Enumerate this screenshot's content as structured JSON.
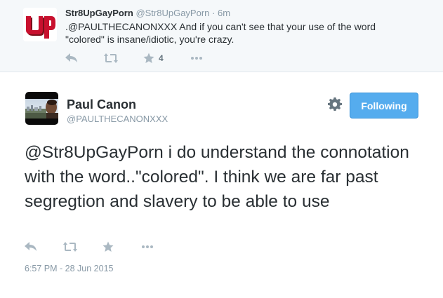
{
  "reply": {
    "name": "Str8UpGayPorn",
    "handle": "@Str8UpGayPorn",
    "separator": "·",
    "time": "6m",
    "text": ".@PAULTHECANONXXX And if you can't see that your use of the word \"colored\" is insane/idiotic, you're crazy.",
    "favorite_count": "4",
    "avatar_logo": "UP"
  },
  "main": {
    "name": "Paul Canon",
    "handle": "@PAULTHECANONXXX",
    "follow_label": "Following",
    "text": "@Str8UpGayPorn i do understand the connotation with the word..\"colored\". I think we are far past segregtion and slavery to be able to use",
    "timestamp": "6:57 PM - 28 Jun 2015"
  },
  "icons": {
    "reply": "reply-icon",
    "retweet": "retweet-icon",
    "favorite": "star-icon",
    "more": "more-icon",
    "settings": "gear-icon"
  },
  "colors": {
    "accent": "#55acee",
    "icon": "#aab8c2",
    "muted": "#8899a6",
    "text": "#292f33",
    "logo_red": "#c8102e"
  }
}
